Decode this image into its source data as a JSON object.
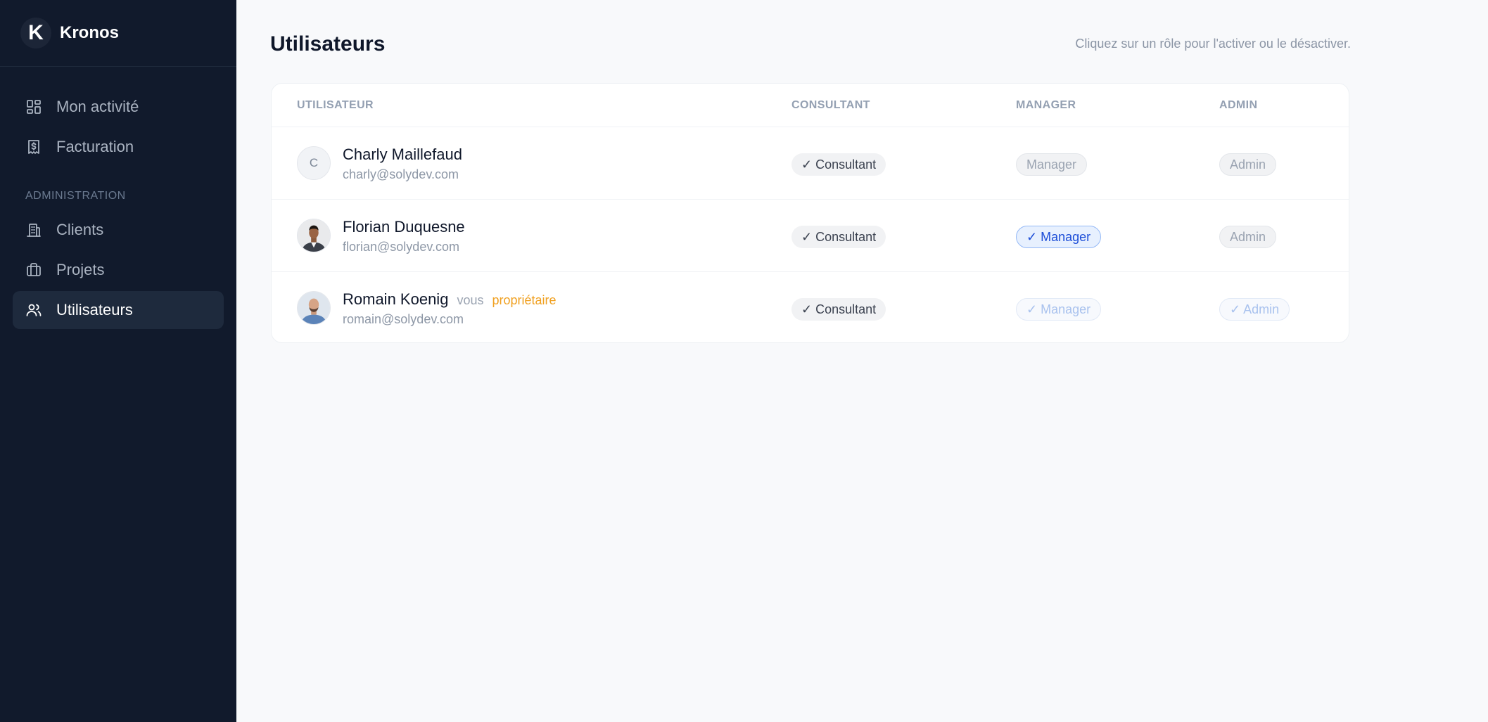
{
  "brand": {
    "logo_letter": "K",
    "name": "Kronos"
  },
  "sidebar": {
    "items": [
      {
        "label": "Mon activité",
        "icon": "dashboard-icon"
      },
      {
        "label": "Facturation",
        "icon": "invoice-icon"
      }
    ],
    "section_label": "ADMINISTRATION",
    "admin_items": [
      {
        "label": "Clients",
        "icon": "building-icon"
      },
      {
        "label": "Projets",
        "icon": "briefcase-icon"
      },
      {
        "label": "Utilisateurs",
        "icon": "users-icon",
        "active": true
      }
    ]
  },
  "page": {
    "title": "Utilisateurs",
    "hint": "Cliquez sur un rôle pour l'activer ou le désactiver."
  },
  "table": {
    "headers": {
      "user": "UTILISATEUR",
      "consultant": "CONSULTANT",
      "manager": "MANAGER",
      "admin": "ADMIN"
    },
    "rows": [
      {
        "initial": "C",
        "name": "Charly Maillefaud",
        "email": "charly@solydev.com",
        "consultant": "✓ Consultant",
        "manager": "Manager",
        "admin": "Admin"
      },
      {
        "name": "Florian Duquesne",
        "email": "florian@solydev.com",
        "consultant": "✓ Consultant",
        "manager": "✓ Manager",
        "admin": "Admin"
      },
      {
        "name": "Romain Koenig",
        "you": "vous",
        "owner": "propriétaire",
        "email": "romain@solydev.com",
        "consultant": "✓ Consultant",
        "manager": "✓ Manager",
        "admin": "✓ Admin"
      }
    ]
  },
  "colors": {
    "sidebar_bg": "#111a2c",
    "accent_blue": "#1d4ed8",
    "owner_orange": "#f0a020"
  }
}
